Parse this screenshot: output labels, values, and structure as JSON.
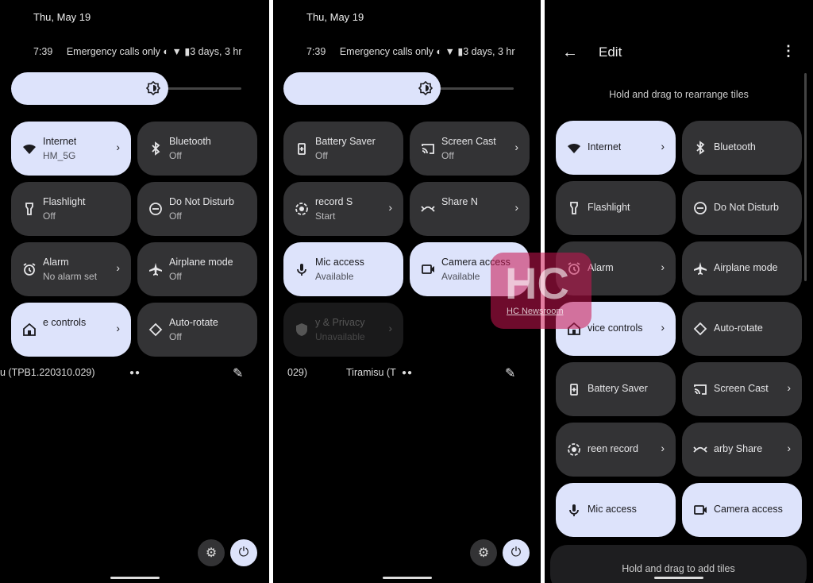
{
  "colors": {
    "tile_on": "#dde3fb",
    "tile_off": "#333335",
    "background": "#000000",
    "watermark": "#c81450"
  },
  "panel1": {
    "date": "Thu, May 19",
    "time": "7:39",
    "carrier": "Emergency calls only",
    "battery": "3 days, 3 hr",
    "brightness_percent": 65,
    "tiles": [
      {
        "label": "Internet",
        "sub": "HM_5G",
        "icon": "wifi-icon",
        "on": true,
        "chevron": true
      },
      {
        "label": "Bluetooth",
        "sub": "Off",
        "icon": "bluetooth-icon",
        "on": false
      },
      {
        "label": "Flashlight",
        "sub": "Off",
        "icon": "flashlight-icon",
        "on": false
      },
      {
        "label": "Do Not Disturb",
        "sub": "Off",
        "icon": "dnd-icon",
        "on": false
      },
      {
        "label": "Alarm",
        "sub": "No alarm set",
        "icon": "alarm-icon",
        "on": false,
        "chevron": true
      },
      {
        "label": "Airplane mode",
        "sub": "Off",
        "icon": "airplane-icon",
        "on": false
      },
      {
        "label": "e controls",
        "icon": "home-icon",
        "on": true,
        "chevron": true
      },
      {
        "label": "Auto-rotate",
        "sub": "Off",
        "icon": "rotate-icon",
        "on": false
      }
    ],
    "build": "u (TPB1.220310.029)",
    "page_dots": "●●"
  },
  "panel2": {
    "date": "Thu, May 19",
    "time": "7:39",
    "carrier": "Emergency calls only",
    "battery": "3 days, 3 hr",
    "brightness_percent": 65,
    "tiles": [
      {
        "label": "Battery Saver",
        "sub": "Off",
        "icon": "battery-saver-icon",
        "on": false
      },
      {
        "label": "Screen Cast",
        "sub": "Off",
        "icon": "cast-icon",
        "on": false,
        "chevron": true
      },
      {
        "label": "record      S",
        "sub": "Start",
        "icon": "screen-record-icon",
        "on": false,
        "chevron": true
      },
      {
        "label": "Share        N",
        "icon": "nearby-share-icon",
        "on": false,
        "chevron": true
      },
      {
        "label": "Mic access",
        "sub": "Available",
        "icon": "mic-icon",
        "on": true
      },
      {
        "label": "Camera access",
        "sub": "Available",
        "icon": "camera-icon",
        "on": true
      },
      {
        "label": "y & Privacy",
        "sub": "Unavailable",
        "icon": "shield-icon",
        "dim": true,
        "chevron": true
      }
    ],
    "build": "029)",
    "build2": "Tiramisu (T",
    "page_dots": "●●"
  },
  "panel3": {
    "title": "Edit",
    "hint": "Hold and drag to rearrange tiles",
    "add_hint": "Hold and drag to add tiles",
    "tiles": [
      {
        "label": "Internet",
        "icon": "wifi-icon",
        "on": true,
        "chevron": true
      },
      {
        "label": "Bluetooth",
        "icon": "bluetooth-icon",
        "on": false
      },
      {
        "label": "Flashlight",
        "icon": "flashlight-icon",
        "on": false
      },
      {
        "label": "Do Not Disturb",
        "icon": "dnd-icon",
        "on": false
      },
      {
        "label": "Alarm",
        "icon": "alarm-icon",
        "on": false,
        "chevron": true
      },
      {
        "label": "Airplane mode",
        "icon": "airplane-icon",
        "on": false
      },
      {
        "label": "vice controls",
        "icon": "home-icon",
        "on": true,
        "chevron": true
      },
      {
        "label": "Auto-rotate",
        "icon": "rotate-icon",
        "on": false
      },
      {
        "label": "Battery Saver",
        "icon": "battery-saver-icon",
        "on": false
      },
      {
        "label": "Screen Cast",
        "icon": "cast-icon",
        "on": false,
        "chevron": true
      },
      {
        "label": "reen record",
        "icon": "screen-record-icon",
        "on": false,
        "chevron": true
      },
      {
        "label": "arby Share",
        "icon": "nearby-share-icon",
        "on": false,
        "chevron": true
      },
      {
        "label": "Mic access",
        "icon": "mic-icon",
        "on": true
      },
      {
        "label": "Camera access",
        "icon": "camera-icon",
        "on": true
      }
    ]
  },
  "watermark": {
    "logo": "HC",
    "text": "HC Newsroom"
  }
}
